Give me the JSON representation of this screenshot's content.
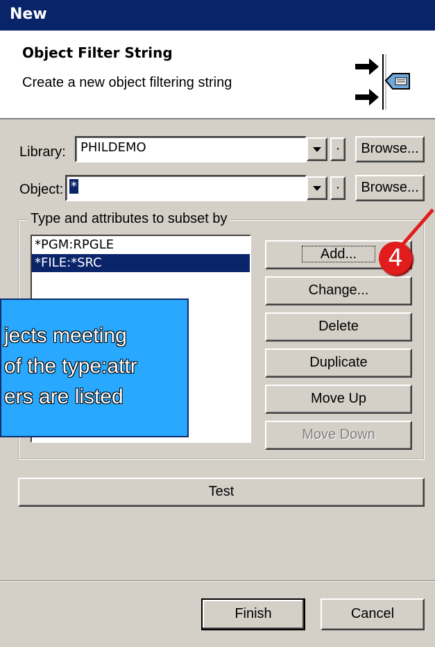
{
  "window": {
    "title": "New"
  },
  "header": {
    "title": "Object Filter String",
    "description": "Create a new object filtering string"
  },
  "form": {
    "library_label": "Library:",
    "library_value": "PHILDEMO",
    "object_label": "Object:",
    "object_value": "*",
    "browse_label": "Browse...",
    "spin_label": "·"
  },
  "group": {
    "title": "Type and attributes to subset by",
    "items": [
      "*PGM:RPGLE",
      "*FILE:*SRC"
    ],
    "selected_index": 1
  },
  "buttons": {
    "add": "Add...",
    "change": "Change...",
    "delete": "Delete",
    "duplicate": "Duplicate",
    "move_up": "Move Up",
    "move_down": "Move Down",
    "test": "Test",
    "finish": "Finish",
    "cancel": "Cancel"
  },
  "callout": {
    "lines": [
      "jects meeting",
      "of the type:attr",
      "ers are listed"
    ]
  },
  "annotation": {
    "step": "4",
    "color": "#e11c1c"
  }
}
